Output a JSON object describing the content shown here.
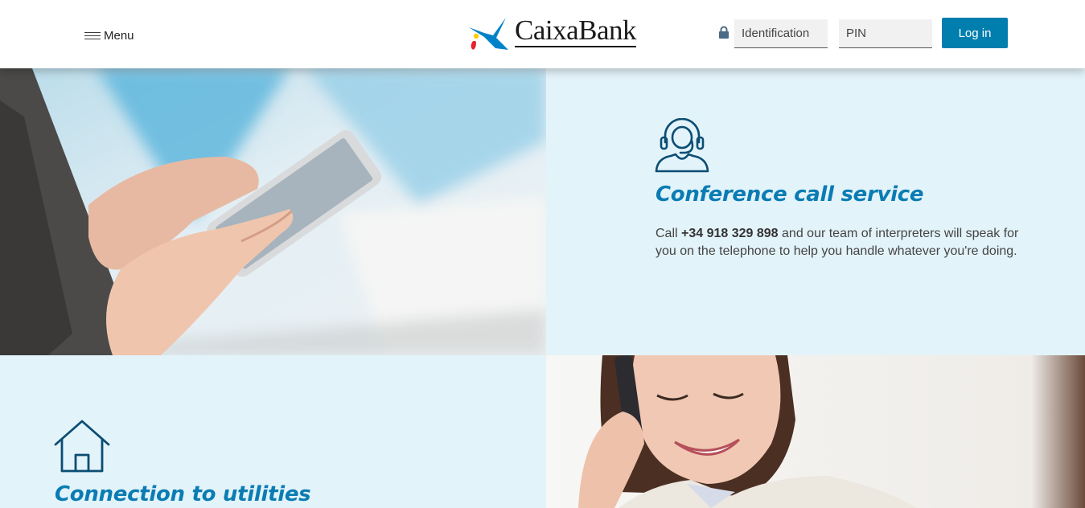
{
  "header": {
    "menu_label": "Menu",
    "logo_text": "CaixaBank",
    "identification_placeholder": "Identification",
    "pin_placeholder": "PIN",
    "login_label": "Log in"
  },
  "features": [
    {
      "title": "Conference call service",
      "body_prefix": "Call ",
      "phone": "+34 918 329 898",
      "body_suffix": " and our team of interpreters will speak for you on the telephone to help you handle whatever you're doing.",
      "icon": "headset-agent-icon"
    },
    {
      "title": "Connection to utilities",
      "icon": "house-icon"
    }
  ],
  "images": {
    "photo_1": "hands-holding-smartphone",
    "photo_2": "smiling-woman-on-phone"
  },
  "colors": {
    "brand_blue": "#007eae",
    "title_blue": "#0a7cb3",
    "tile_background": "#e3f3fa",
    "icon_dark_blue": "#0b4d73"
  }
}
